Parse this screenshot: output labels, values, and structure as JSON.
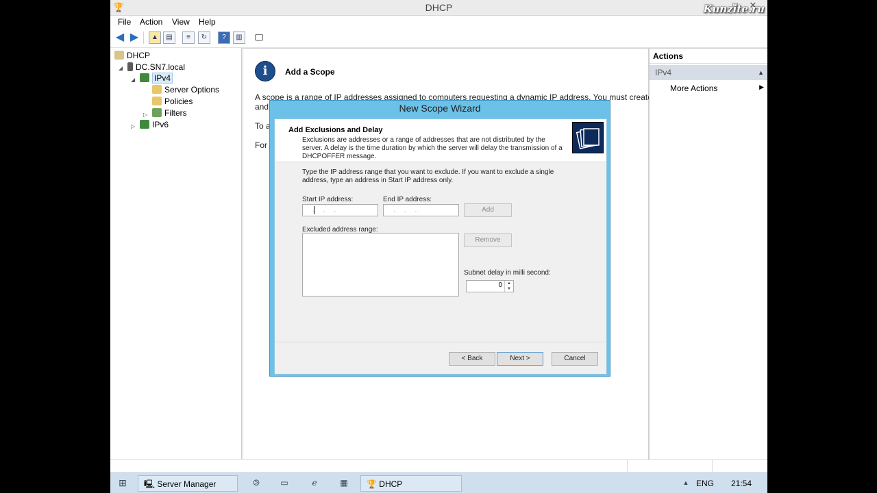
{
  "window": {
    "title": "DHCP",
    "watermark": "Kunzite.ru"
  },
  "menu": [
    "File",
    "Action",
    "View",
    "Help"
  ],
  "tree": {
    "root": "DHCP",
    "server": "DC.SN7.local",
    "ipv4": "IPv4",
    "server_options": "Server Options",
    "policies": "Policies",
    "filters": "Filters",
    "ipv6": "IPv6"
  },
  "center": {
    "heading": "Add a Scope",
    "line1": "A scope is a range of IP addresses assigned to computers requesting a dynamic IP address. You must create",
    "line2": "and",
    "line3": "To a",
    "line4": "For s"
  },
  "actions": {
    "header": "Actions",
    "section": "IPv4",
    "more": "More Actions"
  },
  "wizard": {
    "title": "New Scope Wizard",
    "header_title": "Add Exclusions and Delay",
    "header_desc": "Exclusions are addresses or a range of addresses that are not distributed by the server. A delay is the time duration by which the server will delay the transmission of a DHCPOFFER message.",
    "body_text": "Type the IP address range that you want to exclude. If you want to exclude a single address, type an address in Start IP address only.",
    "start_ip_label": "Start IP address:",
    "end_ip_label": "End IP address:",
    "start_ip_value": "...",
    "end_ip_value": "...",
    "add_label": "Add",
    "excluded_label": "Excluded address range:",
    "remove_label": "Remove",
    "delay_label": "Subnet delay in milli second:",
    "delay_value": "0",
    "back_label": "< Back",
    "next_label": "Next >",
    "cancel_label": "Cancel"
  },
  "taskbar": {
    "server_manager": "Server Manager",
    "dhcp": "DHCP",
    "lang": "ENG",
    "time": "21:54"
  }
}
